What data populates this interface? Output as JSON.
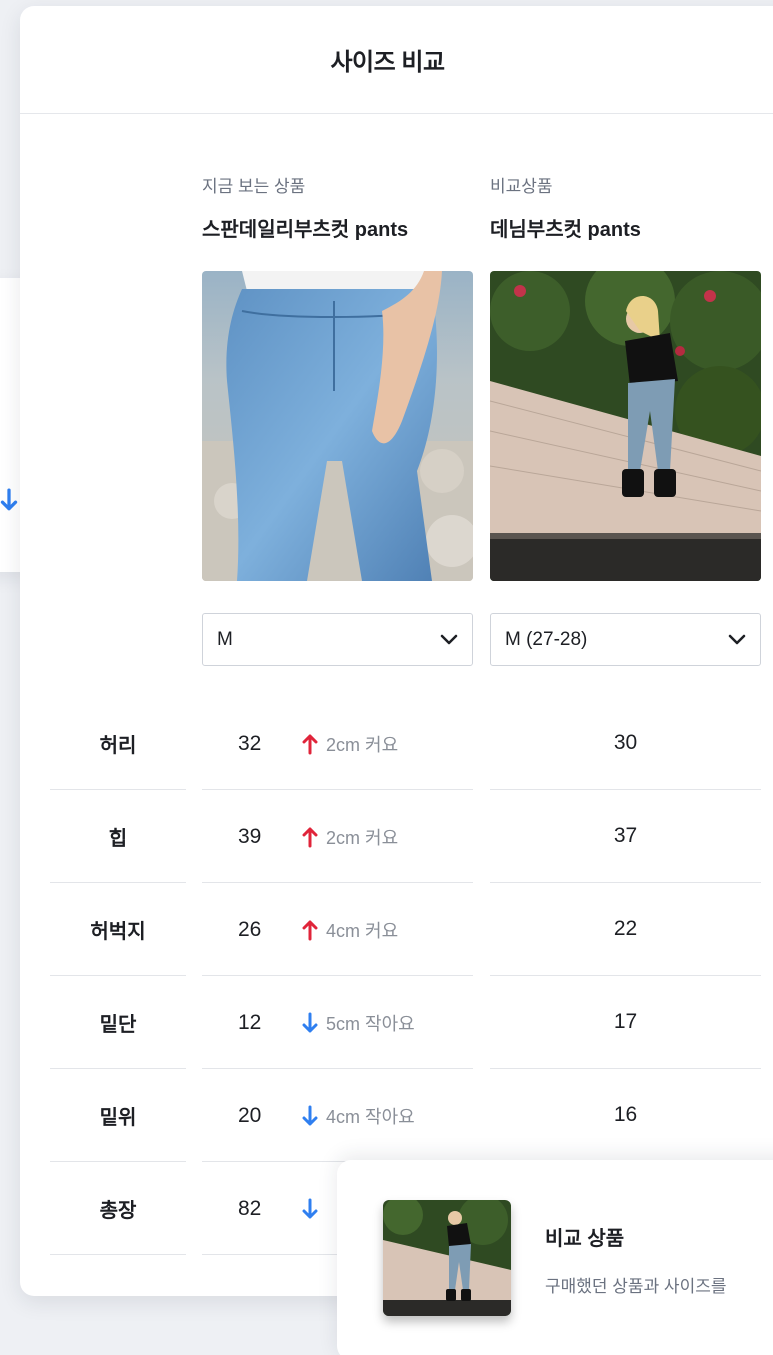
{
  "panel": {
    "title": "사이즈 비교"
  },
  "current": {
    "label": "지금 보는 상품",
    "name": "스판데일리부츠컷 pants",
    "size_selected": "M"
  },
  "compare": {
    "label": "비교상품",
    "name": "데님부츠컷 pants",
    "size_selected": "M (27-28)"
  },
  "rows": [
    {
      "label": "허리",
      "current": "32",
      "diff": "2cm 커요",
      "direction": "up",
      "compare": "30"
    },
    {
      "label": "힙",
      "current": "39",
      "diff": "2cm 커요",
      "direction": "up",
      "compare": "37"
    },
    {
      "label": "허벅지",
      "current": "26",
      "diff": "4cm 커요",
      "direction": "up",
      "compare": "22"
    },
    {
      "label": "밑단",
      "current": "12",
      "diff": "5cm 작아요",
      "direction": "down",
      "compare": "17"
    },
    {
      "label": "밑위",
      "current": "20",
      "diff": "4cm 작아요",
      "direction": "down",
      "compare": "16"
    },
    {
      "label": "총장",
      "current": "82",
      "diff": "",
      "direction": "down",
      "compare": ""
    }
  ],
  "toast": {
    "title": "비교 상품",
    "description": "구매했던 상품과 사이즈를"
  },
  "colors": {
    "up": "#e0243a",
    "down": "#2f7ff0"
  }
}
